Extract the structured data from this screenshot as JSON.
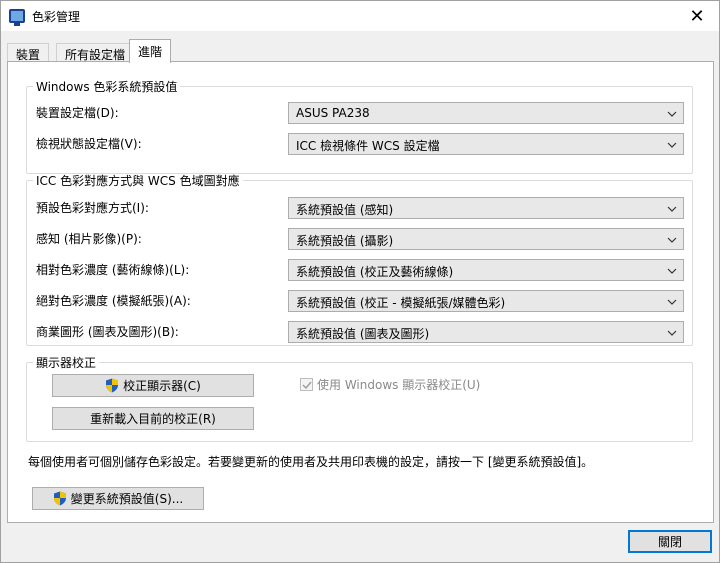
{
  "window": {
    "title": "色彩管理",
    "close_glyph": "✕"
  },
  "tabs": [
    {
      "label": "裝置",
      "active": false
    },
    {
      "label": "所有設定檔",
      "active": false
    },
    {
      "label": "進階",
      "active": true
    }
  ],
  "wcs_defaults": {
    "legend": "Windows 色彩系統預設值",
    "rows": [
      {
        "label": "裝置設定檔(D):",
        "value": "ASUS PA238"
      },
      {
        "label": "檢視狀態設定檔(V):",
        "value": "ICC 檢視條件 WCS 設定檔"
      }
    ]
  },
  "rendering": {
    "legend": "ICC 色彩對應方式與 WCS 色域圖對應",
    "rows": [
      {
        "label": "預設色彩對應方式(I):",
        "value": "系統預設值 (感知)"
      },
      {
        "label": "感知 (相片影像)(P):",
        "value": "系統預設值 (攝影)"
      },
      {
        "label": "相對色彩濃度 (藝術線條)(L):",
        "value": "系統預設值 (校正及藝術線條)"
      },
      {
        "label": "絕對色彩濃度 (模擬紙張)(A):",
        "value": "系統預設值 (校正 - 模擬紙張/媒體色彩)"
      },
      {
        "label": "商業圖形 (圖表及圖形)(B):",
        "value": "系統預設值 (圖表及圖形)"
      }
    ]
  },
  "calibration": {
    "legend": "顯示器校正",
    "calibrate_button": "校正顯示器(C)",
    "reload_button": "重新載入目前的校正(R)",
    "use_windows_calibration": {
      "label": "使用 Windows 顯示器校正(U)",
      "checked": true,
      "disabled": true
    }
  },
  "info_text": "每個使用者可個別儲存色彩設定。若要變更新的使用者及共用印表機的設定，請按一下 [變更系統預設值]。",
  "change_defaults_button": "變更系統預設值(S)...",
  "close_button": "關閉",
  "colors": {
    "accent": "#0078d7",
    "shield_blue": "#1f5fbf",
    "shield_yellow": "#f3c200"
  },
  "icons": {
    "app": "color-management-monitor-icon",
    "dropdown": "chevron-down-icon",
    "uac": "uac-shield-icon"
  }
}
